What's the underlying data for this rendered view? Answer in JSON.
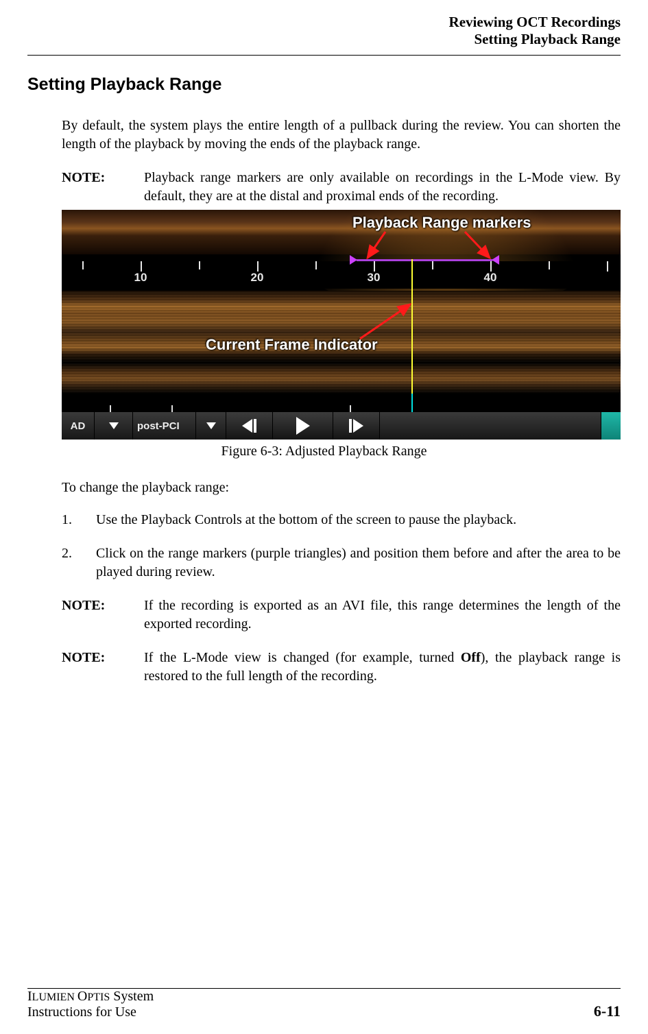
{
  "header": {
    "line1": "Reviewing OCT Recordings",
    "line2": "Setting Playback Range"
  },
  "section_title": "Setting Playback Range",
  "intro": "By default, the system plays the entire length of a pullback during the review. You can shorten the length of the playback by moving the ends of the playback range.",
  "note1": {
    "label": "NOTE:",
    "text": "Playback range markers are only available on recordings in the L-Mode view. By default, they are at the distal and proximal ends of the recording."
  },
  "figure": {
    "annot_markers": "Playback Range markers",
    "annot_frame": "Current Frame Indicator",
    "ruler_ticks": [
      "10",
      "20",
      "30",
      "40"
    ],
    "controls": {
      "ad": "AD",
      "post": "post-PCI"
    },
    "caption": "Figure 6-3:  Adjusted Playback Range"
  },
  "steps_lead": "To change the playback range:",
  "steps": [
    {
      "num": "1.",
      "text": "Use the Playback Controls at the bottom of the screen to pause the playback."
    },
    {
      "num": "2.",
      "text": "Click on the range markers (purple triangles) and position them before and after the area to be played during review."
    }
  ],
  "note2": {
    "label": "NOTE:",
    "text": "If the recording is exported as an AVI file, this range determines the length of the exported recording."
  },
  "note3": {
    "label": "NOTE:",
    "prefix": "If the L-Mode view is changed (for example, turned ",
    "bold": "Off",
    "suffix": "), the playback range is restored to the full length of the recording."
  },
  "footer": {
    "line1a": "I",
    "line1b": "LUMIEN ",
    "line1c": "O",
    "line1d": "PTIS",
    "line1e": " System",
    "line2": "Instructions for Use",
    "page": "6-11"
  }
}
